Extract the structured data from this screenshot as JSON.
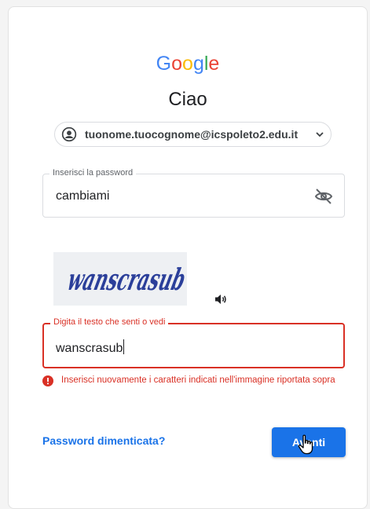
{
  "logo": {
    "letters": [
      "G",
      "o",
      "o",
      "g",
      "l",
      "e"
    ]
  },
  "colors": {
    "google_blue": "#4285f4",
    "google_red": "#ea4335",
    "google_yellow": "#fbbc05",
    "google_green": "#34a853",
    "primary": "#1a73e8",
    "error": "#d93025"
  },
  "greeting": "Ciao",
  "account": {
    "email": "tuonome.tuocognome@icspoleto2.edu.it",
    "avatar_icon": "account-circle-icon",
    "expand_icon": "chevron-down-icon"
  },
  "password": {
    "label": "Inserisci la password",
    "value": "cambiami",
    "toggle_icon": "visibility-off-icon"
  },
  "captcha": {
    "image_text": "wanscrasub",
    "audio_icon": "speaker-icon"
  },
  "captcha_input": {
    "label": "Digita il testo che senti o vedi",
    "value": "wanscrasub"
  },
  "error": {
    "icon": "error-icon",
    "message": "Inserisci nuovamente i caratteri indicati nell'immagine riportata sopra"
  },
  "actions": {
    "forgot": "Password dimenticata?",
    "next": "Avanti"
  }
}
